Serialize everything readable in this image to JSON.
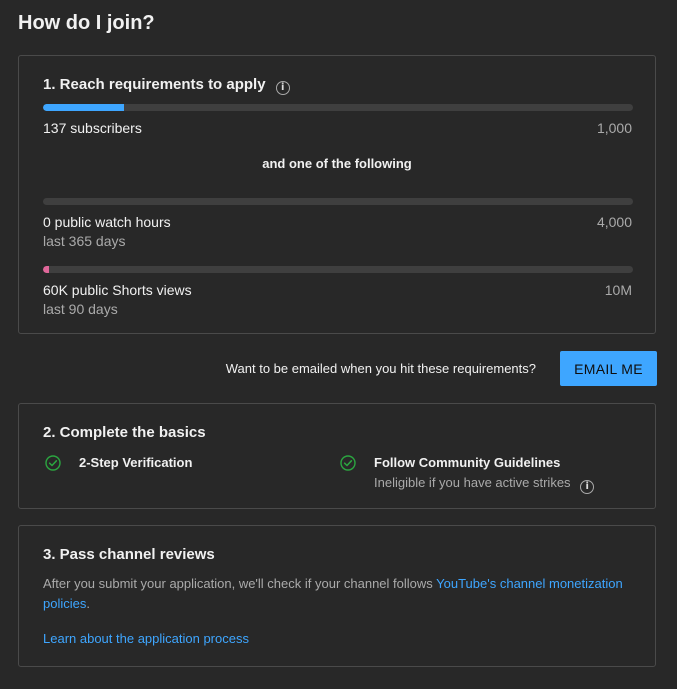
{
  "title": "How do I join?",
  "step1": {
    "heading": "1. Reach requirements to apply",
    "info_icon": "info-icon",
    "subscribers": {
      "label": "137 subscribers",
      "target": "1,000",
      "progress": 0.137,
      "color": "#3ea6ff"
    },
    "divider_text": "and one of the following",
    "watch_hours": {
      "label": "0 public watch hours",
      "sublabel": "last 365 days",
      "target": "4,000",
      "progress": 0
    },
    "shorts_views": {
      "label": "60K public Shorts views",
      "sublabel": "last 90 days",
      "target": "10M",
      "progress": 0.006,
      "color": "#e0679a"
    }
  },
  "email": {
    "prompt": "Want to be emailed when you hit these requirements?",
    "button_label": "EMAIL ME"
  },
  "step2": {
    "heading": "2. Complete the basics",
    "items": [
      {
        "label": "2-Step Verification",
        "icon": "check-circle-icon"
      },
      {
        "label": "Follow Community Guidelines",
        "sublabel": "Ineligible if you have active strikes",
        "icon": "check-circle-icon",
        "info_icon": "info-icon"
      }
    ],
    "check_color": "#2ba640"
  },
  "step3": {
    "heading": "3. Pass channel reviews",
    "text_before": "After you submit your application, we'll check if your channel follows ",
    "link_policies": "YouTube's channel monetization policies",
    "text_after": ".",
    "link_process": "Learn about the application process"
  }
}
